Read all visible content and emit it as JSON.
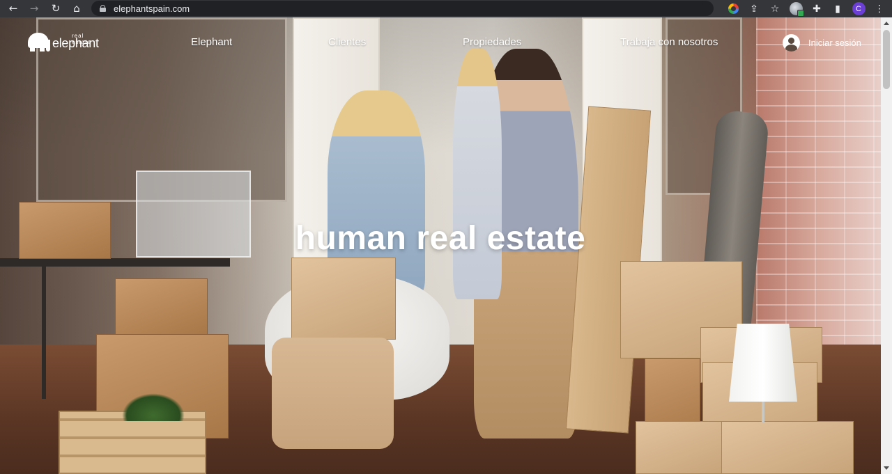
{
  "browser": {
    "url": "elephantspain.com",
    "back_icon": "←",
    "forward_icon": "→",
    "reload_icon": "↻",
    "home_icon": "⌂",
    "share_icon": "⇪",
    "star_icon": "☆",
    "extensions_icon": "✚",
    "sidepanel_icon": "▮",
    "menu_icon": "⋮",
    "profile_initial": "C",
    "profile_color": "#6b3fd4"
  },
  "site": {
    "logo": {
      "tagline": "real estate",
      "name": "elephant"
    },
    "nav": [
      {
        "label": "Elephant"
      },
      {
        "label": "Clientes"
      },
      {
        "label": "Propiedades"
      },
      {
        "label": "Trabaja con nosotros"
      }
    ],
    "login_label": "Iniciar sesión",
    "hero_title": "human real estate"
  }
}
